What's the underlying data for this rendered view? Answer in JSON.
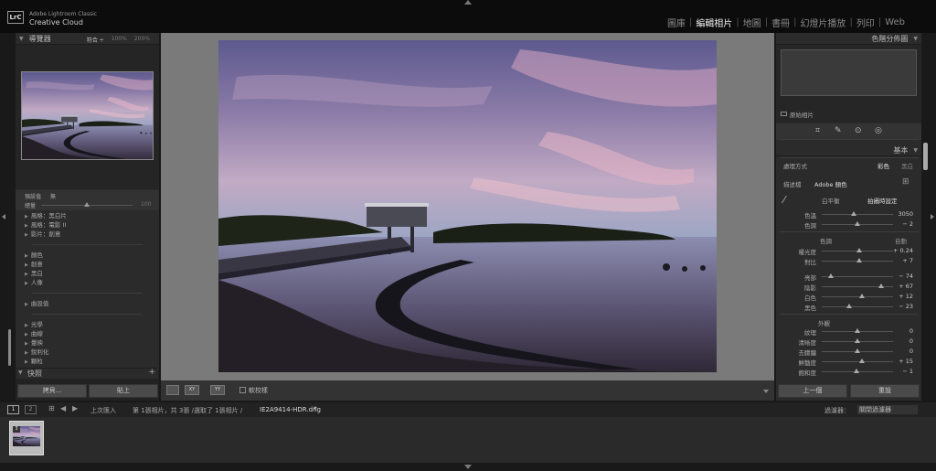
{
  "brand": {
    "logo_text": "LrC",
    "line1": "Adobe Lightroom Classic",
    "line2": "Creative Cloud"
  },
  "modules": [
    "圖庫",
    "編輯相片",
    "地圖",
    "書冊",
    "幻燈片播放",
    "列印",
    "Web"
  ],
  "active_module": "編輯相片",
  "navigator": {
    "title": "導覽器",
    "fit": "符合 ÷",
    "zoom1": "100%",
    "zoom2": "200%"
  },
  "presets": {
    "amount_label": "預設值",
    "amount_value": "無",
    "strength_label": "總量",
    "strength_value": "100",
    "items_group1": [
      "風格：黑白片",
      "風格：電影 II",
      "影片：創意"
    ],
    "items_group2": [
      "顏色",
      "創意",
      "黑白",
      "人像"
    ],
    "items_group3": [
      "曲設值"
    ],
    "items_group4": [
      "光學",
      "曲線",
      "暈映",
      "銳利化",
      "顆粒"
    ]
  },
  "quickshare": {
    "title": "快照",
    "add": "+"
  },
  "left_buttons": {
    "copy": "拷貝...",
    "paste": "貼上"
  },
  "toolbar": {
    "soft_proof": "軟校樣",
    "view1": "▭",
    "view2": "XY",
    "view3": "YY"
  },
  "right_panel": {
    "histogram_title": "色階分佈圖",
    "original_photo": "原始相片",
    "basic_title": "基本",
    "treatment_label": "處理方式",
    "treatment_color": "彩色",
    "treatment_bw": "黑白",
    "profile_label": "描述檔",
    "profile_value": "Adobe 顏色",
    "wb_label": "白平衡",
    "wb_value": "拍攝時設定",
    "tone_label": "色調",
    "tone_auto": "自動",
    "presence_label": "外觀",
    "prev_button": "上一個",
    "reset_button": "重設",
    "sliders_wb": [
      {
        "label": "色溫",
        "value": "3050",
        "pos": 0.45
      },
      {
        "label": "色調",
        "value": "− 2",
        "pos": 0.5
      }
    ],
    "sliders_tone1": [
      {
        "label": "曝光度",
        "value": "+ 0.24",
        "pos": 0.52
      },
      {
        "label": "對比",
        "value": "+ 7",
        "pos": 0.53
      }
    ],
    "sliders_tone2": [
      {
        "label": "亮部",
        "value": "− 74",
        "pos": 0.13
      },
      {
        "label": "陰影",
        "value": "+ 67",
        "pos": 0.83
      },
      {
        "label": "白色",
        "value": "+ 12",
        "pos": 0.56
      },
      {
        "label": "黑色",
        "value": "− 23",
        "pos": 0.38
      }
    ],
    "sliders_presence": [
      {
        "label": "紋理",
        "value": "0",
        "pos": 0.5
      },
      {
        "label": "清晰度",
        "value": "0",
        "pos": 0.5
      },
      {
        "label": "去朦朧",
        "value": "0",
        "pos": 0.5
      },
      {
        "label": "鮮豔度",
        "value": "+ 15",
        "pos": 0.57
      },
      {
        "label": "飽和度",
        "value": "− 1",
        "pos": 0.49
      }
    ]
  },
  "filmstrip": {
    "page1": "1",
    "page2": "2",
    "source": "上次匯入",
    "info": "第 1張相片，共 3張 /選取了 1張相片 /",
    "filename": "IE2A9414-HDR.dng",
    "filter_label": "過濾器：",
    "filter_value": "關閉過濾器",
    "thumb_badge": "3"
  }
}
